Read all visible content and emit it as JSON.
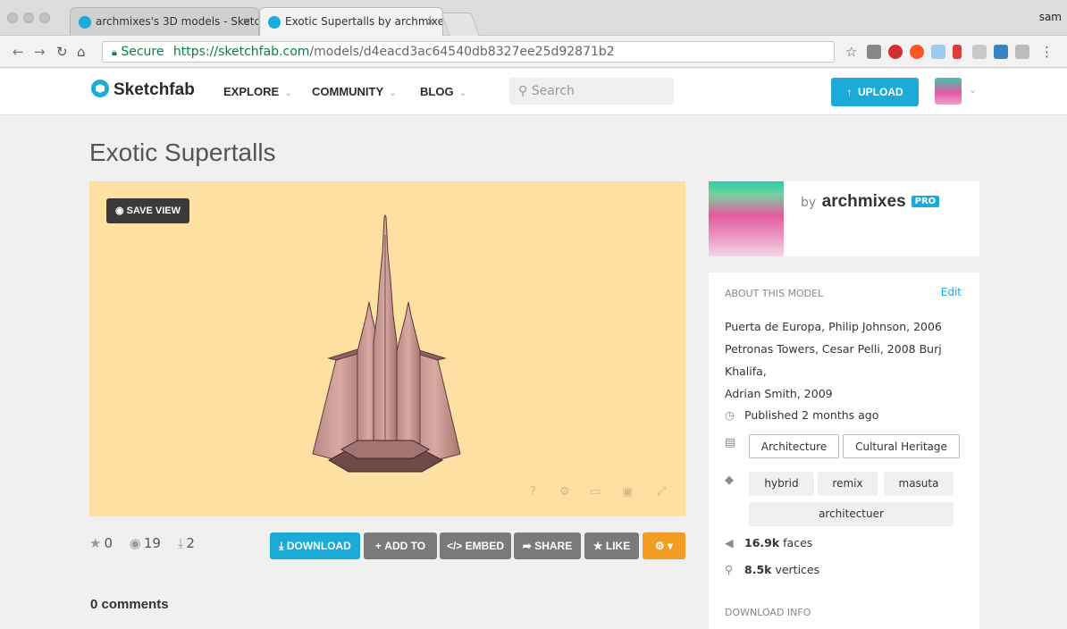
{
  "browser": {
    "tabs": [
      {
        "title": "archmixes's 3D models - Sketc"
      },
      {
        "title": "Exotic Supertalls by archmixes"
      }
    ],
    "profile": "sam",
    "secure_label": "Secure",
    "url_host": "https://sketchfab.com",
    "url_path": "/models/d4eacd3ac64540db8327ee25d92871b2"
  },
  "header": {
    "logo": "Sketchfab",
    "nav": [
      "EXPLORE",
      "COMMUNITY",
      "BLOG"
    ],
    "search_placeholder": "Search",
    "upload_label": "UPLOAD"
  },
  "model": {
    "title": "Exotic Supertalls",
    "save_view": "SAVE VIEW",
    "viewer_bg": "#fde0a2"
  },
  "stats": {
    "likes": "0",
    "views": "19",
    "downloads": "2"
  },
  "actions": {
    "download": "DOWNLOAD",
    "add_to": "ADD TO",
    "embed": "EMBED",
    "share": "SHARE",
    "like": "LIKE"
  },
  "comments": {
    "label": "0 comments"
  },
  "author": {
    "by": "by",
    "name": "archmixes",
    "badge": "PRO"
  },
  "about": {
    "heading": "ABOUT THIS MODEL",
    "edit": "Edit",
    "description_lines": [
      "Puerta de Europa, Philip Johnson, 2006",
      "Petronas Towers, Cesar Pelli, 2008 Burj Khalifa,",
      "Adrian Smith, 2009"
    ],
    "published": "Published 2 months ago",
    "categories": [
      "Architecture",
      "Cultural Heritage"
    ],
    "tags": [
      "hybrid",
      "remix",
      "masuta",
      "architectuer"
    ],
    "faces_value": "16.9k",
    "faces_label": "faces",
    "vertices_value": "8.5k",
    "vertices_label": "vertices",
    "download_info": "DOWNLOAD INFO"
  },
  "colors": {
    "accent": "#1caad9",
    "gray_button": "#7a7a7a",
    "orange_button": "#f39c24"
  }
}
